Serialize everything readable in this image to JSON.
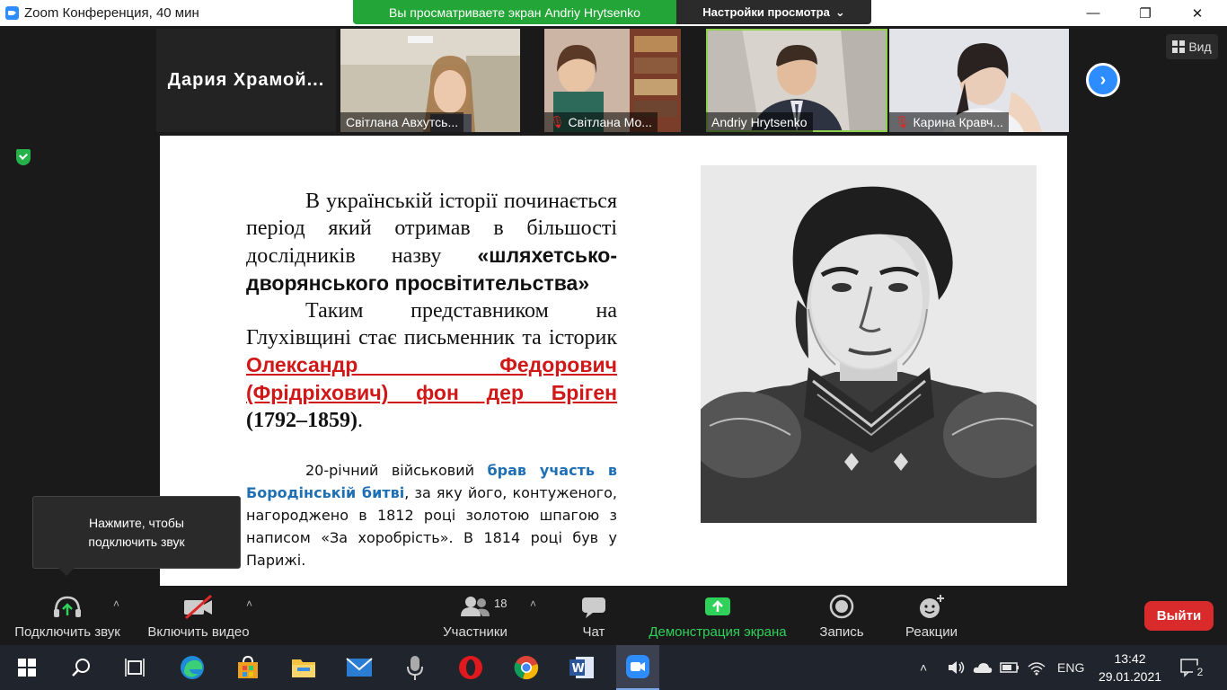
{
  "window": {
    "title": "Zoom Конференция, 40 мин",
    "minimize_glyph": "—",
    "maximize_glyph": "❐",
    "close_glyph": "✕"
  },
  "share_banner": {
    "text": "Вы просматриваете экран Andriy Hrytsenko",
    "view_options": "Настройки просмотра",
    "view_options_caret": "⌄"
  },
  "thumbnails": {
    "name_only": "Дария  Храмой...",
    "items": [
      {
        "name": "Світлана Авхутсь...",
        "muted": false
      },
      {
        "name": "Світлана  Мо...",
        "muted": true
      },
      {
        "name": "Andriy Hrytsenko",
        "muted": false,
        "active": true
      },
      {
        "name": "Карина Кравч...",
        "muted": true
      }
    ],
    "next_glyph": "›"
  },
  "view_button": {
    "label": "Вид",
    "icon": "grid-icon"
  },
  "slide": {
    "p1_text": "В українській історії починається період який отримав в більшості дослідників назву ",
    "p1_bold": "«шляхетсько-дворянського просвітительства»",
    "p2_text": "Таким представником на Глухівщині стає письменник та історик ",
    "p2_name": "Олександр Федорович (Фрідріхович) фон дер Бріген",
    "p2_years": "(1792–1859)",
    "p2_end": ".",
    "p3_start": "20-річний військовий ",
    "p3_blue": "брав участь в Бородінській битві",
    "p3_rest": ", за яку його, контуженого, нагороджено в 1812 році золотою шпагою з написом «За хоробрість». В 1814 році був у Парижі."
  },
  "tooltip": {
    "line1": "Нажмите, чтобы",
    "line2": "подключить звук"
  },
  "toolbar": {
    "audio": "Подключить звук",
    "video": "Включить видео",
    "participants": "Участники",
    "participants_count": "18",
    "chat": "Чат",
    "share": "Демонстрация экрана",
    "record": "Запись",
    "reactions": "Реакции",
    "leave": "Выйти",
    "caret": "˄"
  },
  "taskbar": {
    "apps": [
      "windows-start-icon",
      "search-icon",
      "task-view-icon",
      "edge-icon",
      "store-icon",
      "file-explorer-icon",
      "mail-icon",
      "voice-recorder-icon",
      "opera-icon",
      "chrome-icon",
      "word-icon",
      "zoom-icon"
    ],
    "lang": "ENG",
    "time": "13:42",
    "date": "29.01.2021",
    "notification_count": "2",
    "tray_up_glyph": "˄"
  },
  "colors": {
    "zoom_blue": "#2d8cff",
    "banner_green": "#23a537",
    "leave_red": "#d92b2b",
    "share_green": "#2fd15a",
    "name_red": "#d01818",
    "battle_blue": "#1f6fb5"
  }
}
